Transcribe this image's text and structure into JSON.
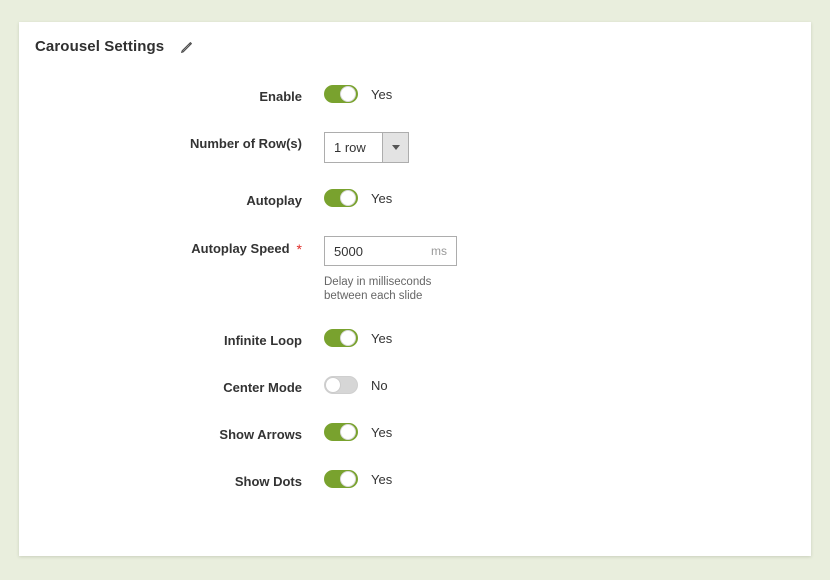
{
  "page": {
    "background_color": "#e9eedd",
    "card_background": "#ffffff"
  },
  "header": {
    "title": "Carousel Settings",
    "edit_icon": "pencil-icon"
  },
  "colors": {
    "toggle_on": "#79a22e",
    "toggle_off": "#d6d6d6",
    "required_asterisk": "#e02b27",
    "label": "#333333"
  },
  "form": {
    "fields": [
      {
        "type": "toggle",
        "name": "enable",
        "label": "Enable",
        "state": "on",
        "state_text": "Yes"
      },
      {
        "type": "select",
        "name": "number-of-rows",
        "label": "Number of Row(s)",
        "value": "1 row",
        "caret_icon": "chevron-down-icon"
      },
      {
        "type": "toggle",
        "name": "autoplay",
        "label": "Autoplay",
        "state": "on",
        "state_text": "Yes"
      },
      {
        "type": "input",
        "name": "autoplay-speed",
        "label": "Autoplay Speed",
        "required": true,
        "required_marker": "*",
        "value": "5000",
        "unit": "ms",
        "note": "Delay in milliseconds between each slide"
      },
      {
        "type": "toggle",
        "name": "infinite-loop",
        "label": "Infinite Loop",
        "state": "on",
        "state_text": "Yes"
      },
      {
        "type": "toggle",
        "name": "center-mode",
        "label": "Center Mode",
        "state": "off",
        "state_text": "No"
      },
      {
        "type": "toggle",
        "name": "show-arrows",
        "label": "Show Arrows",
        "state": "on",
        "state_text": "Yes"
      },
      {
        "type": "toggle",
        "name": "show-dots",
        "label": "Show Dots",
        "state": "on",
        "state_text": "Yes"
      }
    ]
  }
}
